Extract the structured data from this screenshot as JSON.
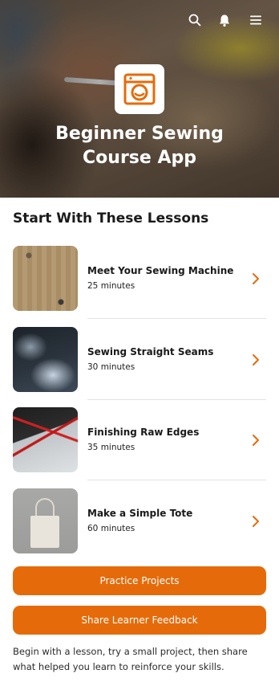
{
  "header": {
    "app_title": "Beginner Sewing\nCourse App",
    "icons": [
      "search-icon",
      "bell-icon",
      "menu-icon"
    ]
  },
  "section": {
    "title": "Start With These Lessons"
  },
  "lessons": [
    {
      "title": "Meet Your Sewing Machine",
      "duration": "25 minutes"
    },
    {
      "title": "Sewing Straight Seams",
      "duration": "30 minutes"
    },
    {
      "title": "Finishing Raw Edges",
      "duration": "35 minutes"
    },
    {
      "title": "Make a Simple Tote",
      "duration": "60 minutes"
    }
  ],
  "buttons": {
    "practice": "Practice Projects",
    "feedback": "Share Learner Feedback"
  },
  "footer": {
    "text": "Begin with a lesson, try a small project, then share what helped you learn to reinforce your skills."
  },
  "colors": {
    "accent": "#e56b0a",
    "text": "#1a1a1a"
  }
}
